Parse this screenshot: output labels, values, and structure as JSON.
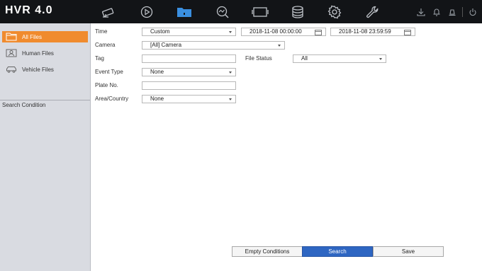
{
  "app": {
    "title": "HVR 4.0"
  },
  "nav": [
    "camera-icon",
    "playback-icon",
    "file-folder-icon",
    "smart-analysis-icon",
    "monitor-icon",
    "storage-icon",
    "settings-gear-icon",
    "maintenance-wrench-icon"
  ],
  "tray": [
    "download-icon",
    "alarm-bell-icon",
    "notification-icon",
    "power-icon"
  ],
  "sidebar": {
    "items": [
      {
        "label": "All Files",
        "icon": "folder-icon",
        "active": true
      },
      {
        "label": "Human Files",
        "icon": "person-icon"
      },
      {
        "label": "Vehicle Files",
        "icon": "car-icon"
      }
    ],
    "section": "Search Condition"
  },
  "form": {
    "time": {
      "label": "Time",
      "value": "Custom",
      "start": "2018-11-08 00:00:00",
      "end": "2018-11-08 23:59:59"
    },
    "camera": {
      "label": "Camera",
      "value": "[All] Camera"
    },
    "tag": {
      "label": "Tag",
      "value": ""
    },
    "file_status": {
      "label": "File Status",
      "value": "All"
    },
    "event_type": {
      "label": "Event Type",
      "value": "None"
    },
    "plate_no": {
      "label": "Plate No.",
      "value": ""
    },
    "area_country": {
      "label": "Area/Country",
      "value": "None"
    }
  },
  "buttons": {
    "empty": "Empty Conditions",
    "search": "Search",
    "save": "Save"
  },
  "colors": {
    "accent": "#f08b2e",
    "primary": "#2e66c2",
    "topbar": "#121417",
    "sidebar": "#d9dbe1",
    "nav_active": "#3a8fe0"
  }
}
